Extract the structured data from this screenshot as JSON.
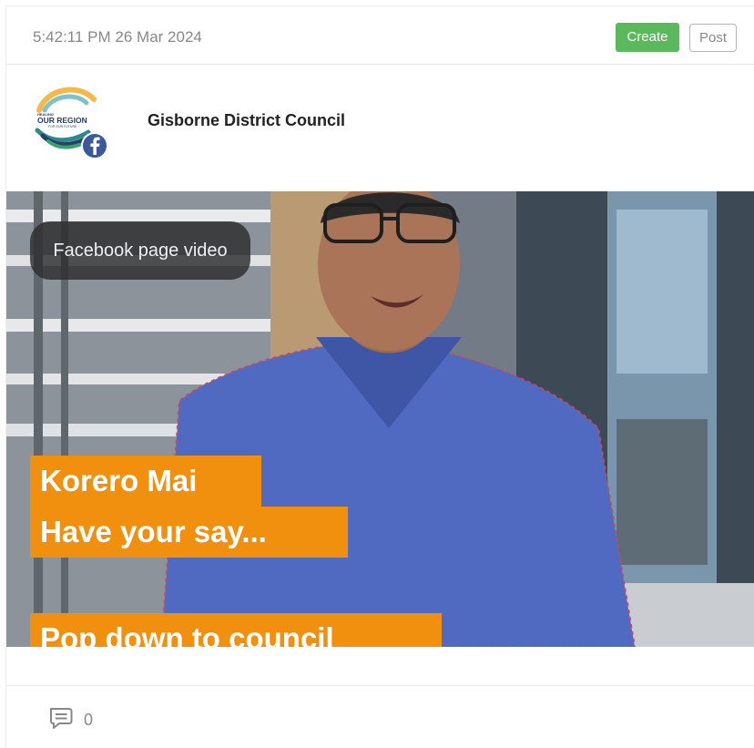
{
  "header": {
    "timestamp": "5:42:11 PM 26 Mar 2024",
    "create_label": "Create",
    "post_label": "Post"
  },
  "author": {
    "name": "Gisborne District Council",
    "logo_text_top": "HEALING",
    "logo_text_main": "OUR REGION",
    "logo_text_bottom": "FOR OUR FUTURE",
    "platform_icon": "facebook-icon"
  },
  "media": {
    "badge": "Facebook page video",
    "caption_lines": [
      "Korero Mai",
      "Have your say...",
      "Pop down to council"
    ]
  },
  "footer": {
    "comment_icon": "comment-icon",
    "comment_count": "0"
  },
  "colors": {
    "create_green": "#5cb85c",
    "caption_orange": "#f0900e",
    "facebook_blue": "#3b5998"
  }
}
